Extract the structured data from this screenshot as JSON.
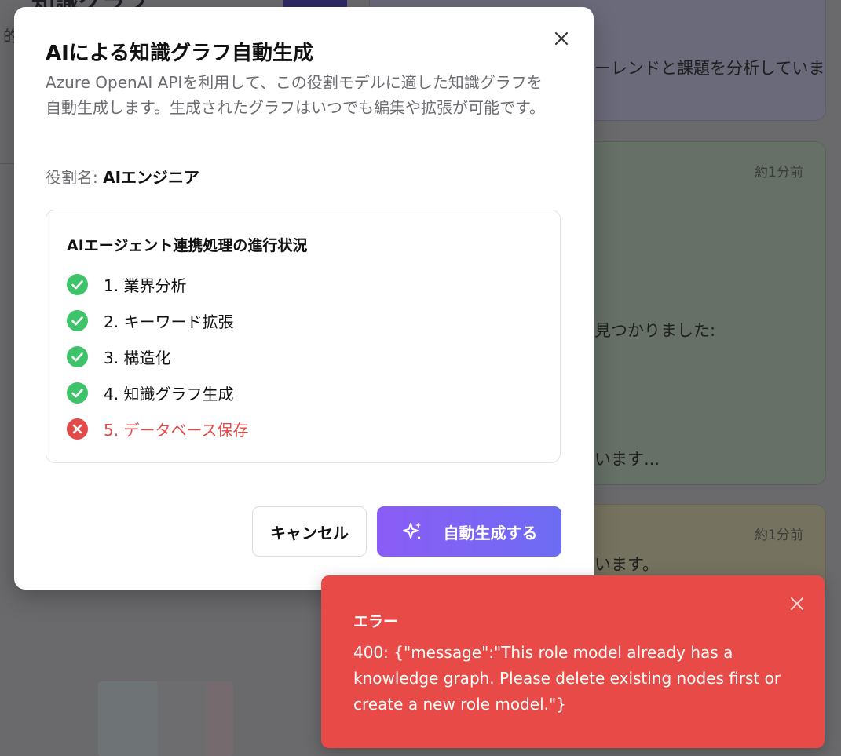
{
  "background": {
    "title": "知識グラフ",
    "left_fragment": "的",
    "card1_text": "ーレンドと課題を分析していま",
    "card2_time": "約1分前",
    "card2_text_found": "見つかりました:",
    "card2_text_progress": "います...",
    "card3_time": "約1分前",
    "card3_text": "います。"
  },
  "modal": {
    "title": "AIによる知識グラフ自動生成",
    "description": "Azure OpenAI APIを利用して、この役割モデルに適した知識グラフを自動生成します。生成されたグラフはいつでも編集や拡張が可能です。",
    "role_label": "役割名: ",
    "role_value": "AIエンジニア",
    "close_icon": "close-icon",
    "progress": {
      "title": "AIエージェント連携処理の進行状況",
      "steps": [
        {
          "label": "1. 業界分析",
          "status": "done"
        },
        {
          "label": "2. キーワード拡張",
          "status": "done"
        },
        {
          "label": "3. 構造化",
          "status": "done"
        },
        {
          "label": "4. 知識グラフ生成",
          "status": "done"
        },
        {
          "label": "5. データベース保存",
          "status": "error"
        }
      ]
    },
    "buttons": {
      "cancel_label": "キャンセル",
      "generate_label": "自動生成する"
    }
  },
  "toast": {
    "title": "エラー",
    "message": "400: {\"message\":\"This role model already has a knowledge graph. Please delete existing nodes first or create a new role model.\"}"
  },
  "colors": {
    "success": "#3ec26a",
    "error": "#e34948",
    "toast_bg": "#e84b47",
    "accent_start": "#8b5cf6",
    "accent_end": "#6d6cf3"
  }
}
